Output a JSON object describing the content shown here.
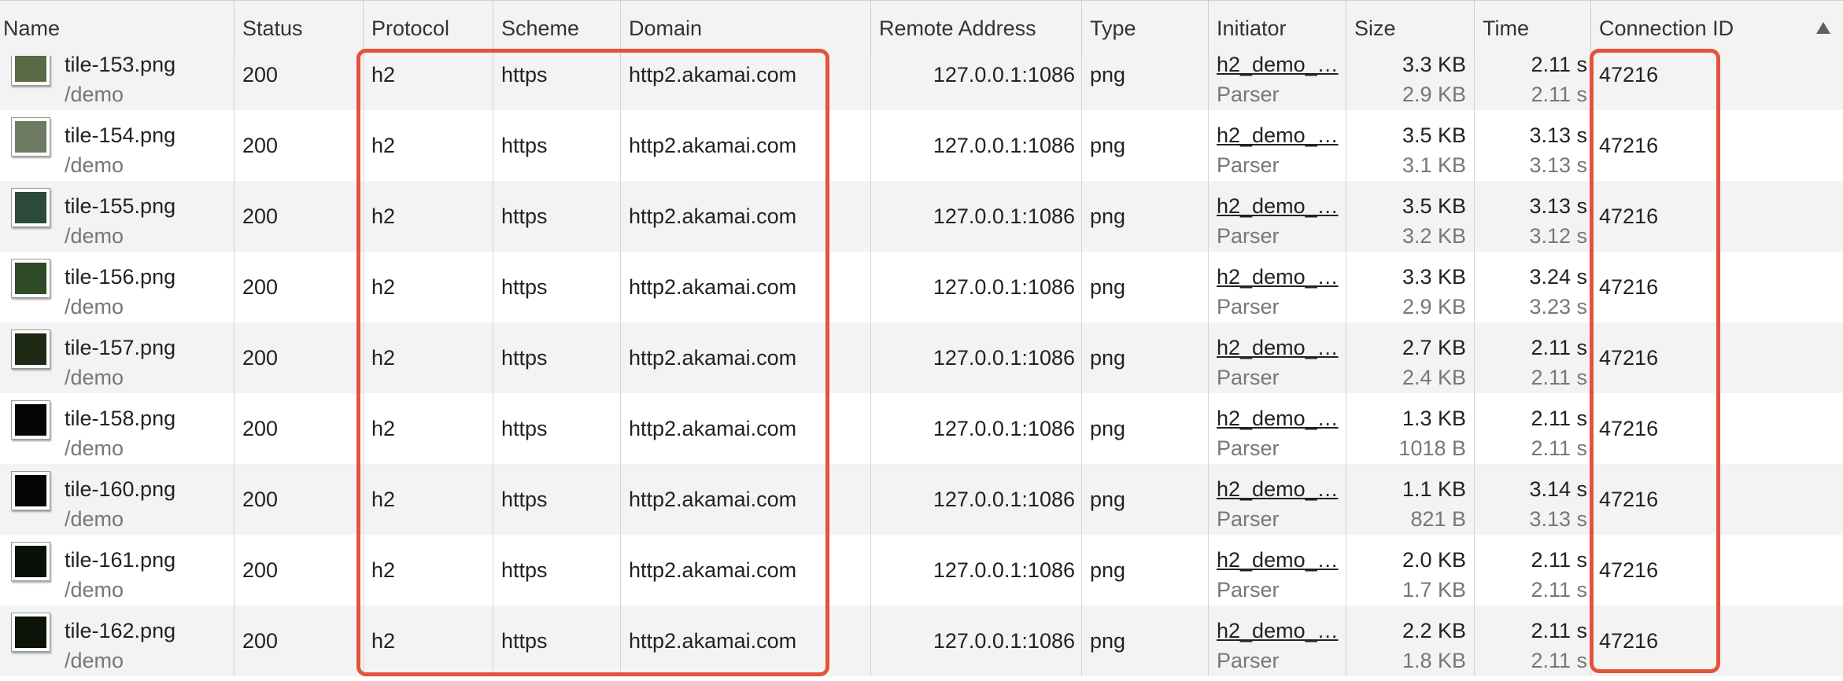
{
  "columns": {
    "name": "Name",
    "status": "Status",
    "protocol": "Protocol",
    "scheme": "Scheme",
    "domain": "Domain",
    "remote_address": "Remote Address",
    "type": "Type",
    "initiator": "Initiator",
    "size": "Size",
    "time": "Time",
    "connection_id": "Connection ID"
  },
  "sort": {
    "column": "Connection ID",
    "direction": "ascending",
    "icon": "sort-up-triangle-icon"
  },
  "highlight_color": "#e4533a",
  "rows": [
    {
      "name": "tile-153.png",
      "path": "/demo",
      "status": "200",
      "protocol": "h2",
      "scheme": "https",
      "domain": "http2.akamai.com",
      "remote": "127.0.0.1:1086",
      "type": "png",
      "initiator": "h2_demo_…",
      "initiator_sub": "Parser",
      "size": "3.3 KB",
      "size_sub": "2.9 KB",
      "time": "2.11 s",
      "time_sub": "2.11 s",
      "conn": "47216",
      "thumb": "#5a6a45"
    },
    {
      "name": "tile-154.png",
      "path": "/demo",
      "status": "200",
      "protocol": "h2",
      "scheme": "https",
      "domain": "http2.akamai.com",
      "remote": "127.0.0.1:1086",
      "type": "png",
      "initiator": "h2_demo_…",
      "initiator_sub": "Parser",
      "size": "3.5 KB",
      "size_sub": "3.1 KB",
      "time": "3.13 s",
      "time_sub": "3.13 s",
      "conn": "47216",
      "thumb": "#6f7a63"
    },
    {
      "name": "tile-155.png",
      "path": "/demo",
      "status": "200",
      "protocol": "h2",
      "scheme": "https",
      "domain": "http2.akamai.com",
      "remote": "127.0.0.1:1086",
      "type": "png",
      "initiator": "h2_demo_…",
      "initiator_sub": "Parser",
      "size": "3.5 KB",
      "size_sub": "3.2 KB",
      "time": "3.13 s",
      "time_sub": "3.12 s",
      "conn": "47216",
      "thumb": "#2c4a3a"
    },
    {
      "name": "tile-156.png",
      "path": "/demo",
      "status": "200",
      "protocol": "h2",
      "scheme": "https",
      "domain": "http2.akamai.com",
      "remote": "127.0.0.1:1086",
      "type": "png",
      "initiator": "h2_demo_…",
      "initiator_sub": "Parser",
      "size": "3.3 KB",
      "size_sub": "2.9 KB",
      "time": "3.24 s",
      "time_sub": "3.23 s",
      "conn": "47216",
      "thumb": "#2f4a26"
    },
    {
      "name": "tile-157.png",
      "path": "/demo",
      "status": "200",
      "protocol": "h2",
      "scheme": "https",
      "domain": "http2.akamai.com",
      "remote": "127.0.0.1:1086",
      "type": "png",
      "initiator": "h2_demo_…",
      "initiator_sub": "Parser",
      "size": "2.7 KB",
      "size_sub": "2.4 KB",
      "time": "2.11 s",
      "time_sub": "2.11 s",
      "conn": "47216",
      "thumb": "#1e2a14"
    },
    {
      "name": "tile-158.png",
      "path": "/demo",
      "status": "200",
      "protocol": "h2",
      "scheme": "https",
      "domain": "http2.akamai.com",
      "remote": "127.0.0.1:1086",
      "type": "png",
      "initiator": "h2_demo_…",
      "initiator_sub": "Parser",
      "size": "1.3 KB",
      "size_sub": "1018 B",
      "time": "2.11 s",
      "time_sub": "2.11 s",
      "conn": "47216",
      "thumb": "#050505"
    },
    {
      "name": "tile-160.png",
      "path": "/demo",
      "status": "200",
      "protocol": "h2",
      "scheme": "https",
      "domain": "http2.akamai.com",
      "remote": "127.0.0.1:1086",
      "type": "png",
      "initiator": "h2_demo_…",
      "initiator_sub": "Parser",
      "size": "1.1 KB",
      "size_sub": "821 B",
      "time": "3.14 s",
      "time_sub": "3.13 s",
      "conn": "47216",
      "thumb": "#050505"
    },
    {
      "name": "tile-161.png",
      "path": "/demo",
      "status": "200",
      "protocol": "h2",
      "scheme": "https",
      "domain": "http2.akamai.com",
      "remote": "127.0.0.1:1086",
      "type": "png",
      "initiator": "h2_demo_…",
      "initiator_sub": "Parser",
      "size": "2.0 KB",
      "size_sub": "1.7 KB",
      "time": "2.11 s",
      "time_sub": "2.11 s",
      "conn": "47216",
      "thumb": "#0a0f08"
    },
    {
      "name": "tile-162.png",
      "path": "/demo",
      "status": "200",
      "protocol": "h2",
      "scheme": "https",
      "domain": "http2.akamai.com",
      "remote": "127.0.0.1:1086",
      "type": "png",
      "initiator": "h2_demo_…",
      "initiator_sub": "Parser",
      "size": "2.2 KB",
      "size_sub": "1.8 KB",
      "time": "2.11 s",
      "time_sub": "2.11 s",
      "conn": "47216",
      "thumb": "#0c140a"
    }
  ]
}
